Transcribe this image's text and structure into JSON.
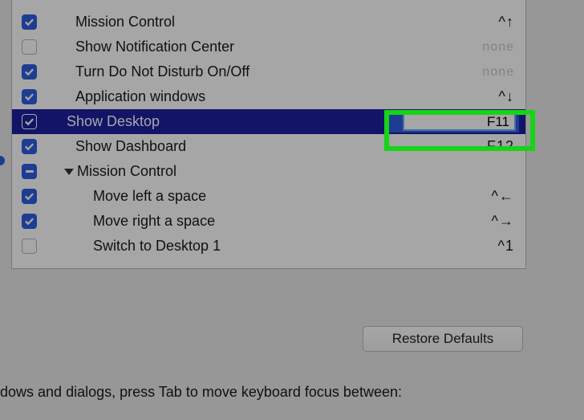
{
  "rows": [
    {
      "label": "Mission Control",
      "shortcut": "^↑",
      "checked": true,
      "dimmed": false,
      "level": 0
    },
    {
      "label": "Show Notification Center",
      "shortcut": "none",
      "checked": false,
      "dimmed": true,
      "level": 0
    },
    {
      "label": "Turn Do Not Disturb On/Off",
      "shortcut": "none",
      "checked": true,
      "dimmed": true,
      "level": 0
    },
    {
      "label": "Application windows",
      "shortcut": "^↓",
      "checked": true,
      "dimmed": false,
      "level": 0
    },
    {
      "label": "Show Desktop",
      "shortcut": "F11",
      "checked": true,
      "dimmed": false,
      "level": 0,
      "selected": true,
      "editing": true
    },
    {
      "label": "Show Dashboard",
      "shortcut": "F12",
      "checked": true,
      "dimmed": false,
      "level": 0
    },
    {
      "label": "Mission Control",
      "shortcut": "",
      "checked": "mixed",
      "dimmed": false,
      "level": 1,
      "group": true
    },
    {
      "label": "Move left a space",
      "shortcut": "^←",
      "checked": true,
      "dimmed": false,
      "level": 2
    },
    {
      "label": "Move right a space",
      "shortcut": "^→",
      "checked": true,
      "dimmed": false,
      "level": 2
    },
    {
      "label": "Switch to Desktop 1",
      "shortcut": "^1",
      "checked": false,
      "dimmed": false,
      "level": 2
    }
  ],
  "restore_label": "Restore Defaults",
  "footer_text": "ndows and dialogs, press Tab to move keyboard focus between:"
}
